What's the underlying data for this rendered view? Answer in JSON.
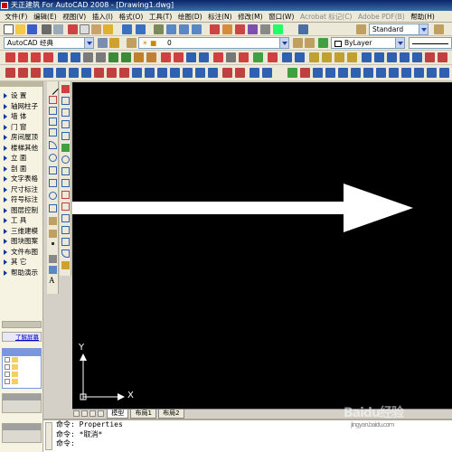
{
  "window": {
    "title": "天正建筑 For AutoCAD 2008 - [Drawing1.dwg]"
  },
  "menu": [
    "文件(F)",
    "编辑(E)",
    "视图(V)",
    "插入(I)",
    "格式(O)",
    "工具(T)",
    "绘图(D)",
    "标注(N)",
    "修改(M)",
    "窗口(W)",
    "Acrobat 标记(C)",
    "Adobe PDF(B)",
    "帮助(H)"
  ],
  "toolbars": {
    "workspace_combo": "AutoCAD 经典",
    "layer_combo": "0",
    "text_style_combo": "Standard",
    "color_combo": "ByLayer",
    "linetype_combo": "ByLayer"
  },
  "tangent_panel": {
    "items": [
      "设 置",
      "轴网柱子",
      "墙 体",
      "门 窗",
      "房间屋顶",
      "楼梯其他",
      "立 面",
      "剖 面",
      "文字表格",
      "尺寸标注",
      "符号标注",
      "图层控制",
      "工 具",
      "三维建模",
      "图块图案",
      "文件布图",
      "其 它",
      "帮助演示"
    ],
    "help_link": "了解屏幕"
  },
  "canvas": {
    "ucs_x": "X",
    "ucs_y": "Y",
    "background": "#000000",
    "arrow_color": "#ffffff"
  },
  "layout_tabs": [
    "模型",
    "布局1",
    "布局2"
  ],
  "command_lines": [
    "命令: Properties",
    "命令: *取消*",
    "命令:"
  ],
  "watermark": {
    "text": "Baidu经验",
    "sub": "jingyan.baidu.com"
  }
}
